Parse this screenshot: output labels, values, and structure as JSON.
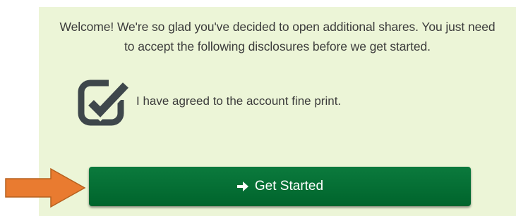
{
  "welcome": {
    "line1": "Welcome! We're so glad you've decided to open additional shares. You just need",
    "line2": "to accept the following disclosures before we get started."
  },
  "disclosure": {
    "checked": true,
    "icon": "checkbox-checked-icon",
    "label": "I have agreed to the account fine print."
  },
  "actions": {
    "get_started_label": "Get Started",
    "get_started_icon": "arrow-right-icon"
  },
  "callout": {
    "icon": "arrow-right-callout-icon",
    "color": "#e97b30"
  },
  "colors": {
    "panel_background": "#ecf5d7",
    "button_green": "#00642c",
    "checkbox_gray": "#3e474b"
  }
}
